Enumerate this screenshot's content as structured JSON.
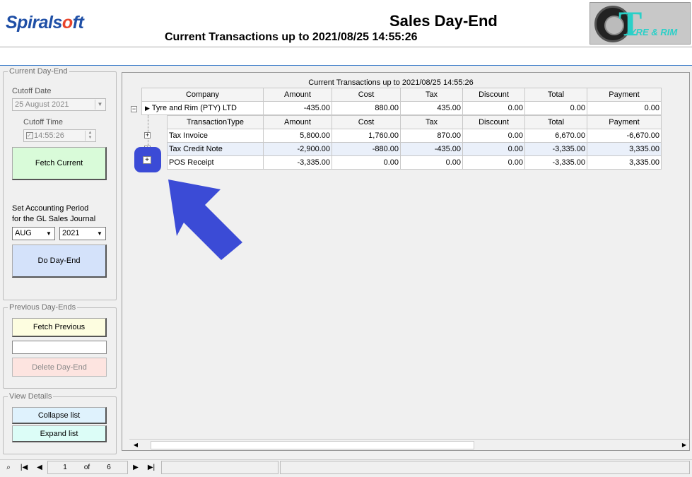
{
  "header": {
    "logo_text_a": "Spirals",
    "logo_text_o": "o",
    "logo_text_b": "ft",
    "title": "Sales Day-End",
    "subtitle": "Current Transactions up to  2021/08/25 14:55:26",
    "brand_letter": "T",
    "brand_text": "YRE & RIM"
  },
  "current_dayend": {
    "group_label": "Current Day-End",
    "cutoff_date_label": "Cutoff Date",
    "cutoff_date_value": "25   August   2021",
    "cutoff_time_label": "Cutoff Time",
    "cutoff_time_value": "14:55:26",
    "fetch_current": "Fetch Current",
    "period_label_1": "Set Accounting  Period",
    "period_label_2": "for the GL Sales Journal",
    "month": "AUG",
    "year": "2021",
    "do_dayend": "Do Day-End"
  },
  "previous_dayends": {
    "group_label": "Previous Day-Ends",
    "fetch_previous": "Fetch Previous",
    "previous_value": "",
    "delete_dayend": "Delete Day-End"
  },
  "view_details": {
    "group_label": "View Details",
    "collapse": "Collapse list",
    "expand": "Expand list"
  },
  "grid": {
    "caption": "Current Transactions up to  2021/08/25 14:55:26",
    "columns": [
      "Company",
      "Amount",
      "Cost",
      "Tax",
      "Discount",
      "Total",
      "Payment"
    ],
    "company_row": [
      "Tyre and Rim (PTY) LTD",
      "-435.00",
      "880.00",
      "435.00",
      "0.00",
      "0.00",
      "0.00"
    ],
    "sub_columns": [
      "TransactionType",
      "Amount",
      "Cost",
      "Tax",
      "Discount",
      "Total",
      "Payment"
    ],
    "rows": [
      [
        "Tax Invoice",
        "5,800.00",
        "1,760.00",
        "870.00",
        "0.00",
        "6,670.00",
        "-6,670.00"
      ],
      [
        "Tax Credit Note",
        "-2,900.00",
        "-880.00",
        "-435.00",
        "0.00",
        "-3,335.00",
        "3,335.00"
      ],
      [
        "POS Receipt",
        "-3,335.00",
        "0.00",
        "0.00",
        "0.00",
        "-3,335.00",
        "3,335.00"
      ]
    ]
  },
  "navigator": {
    "page": "1",
    "of": "of",
    "total": "6"
  },
  "colors": {
    "highlight": "#3b4bd6",
    "fetch_current_bg": "#d9fbd9",
    "do_dayend_bg": "#d4e2fa",
    "fetch_previous_bg": "#fdfde0",
    "delete_dayend_bg": "#fde4e0",
    "collapse_bg": "#dff2fd",
    "expand_bg": "#dcfdf7"
  }
}
